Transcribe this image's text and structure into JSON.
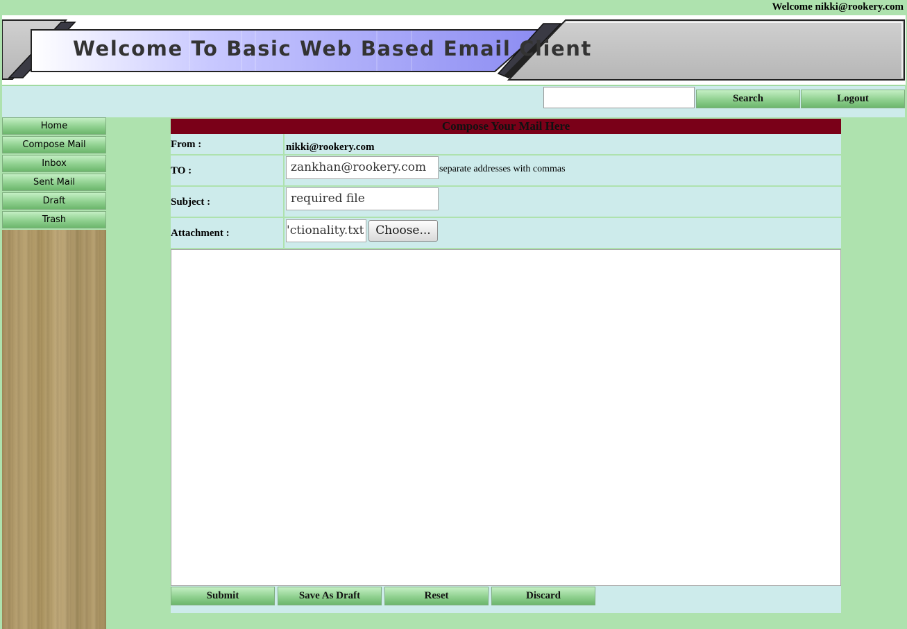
{
  "header": {
    "welcome": "Welcome nikki@rookery.com",
    "banner_title": "Welcome To Basic Web Based Email Client"
  },
  "toolbar": {
    "search_value": "",
    "search_label": "Search",
    "logout_label": "Logout"
  },
  "sidebar": {
    "items": [
      {
        "label": "Home"
      },
      {
        "label": "Compose Mail"
      },
      {
        "label": "Inbox"
      },
      {
        "label": "Sent Mail"
      },
      {
        "label": "Draft"
      },
      {
        "label": "Trash"
      }
    ]
  },
  "compose": {
    "title": "Compose Your Mail Here",
    "from_label": "From :",
    "from_value": "nikki@rookery.com",
    "to_label": "TO :",
    "to_value": "zankhan@rookery.com",
    "to_hint": "separate addresses with commas",
    "subject_label": "Subject :",
    "subject_value": "required file",
    "attachment_label": "Attachment :",
    "attachment_value": "ctionality.txt'",
    "choose_label": "Choose...",
    "body": ""
  },
  "actions": {
    "submit": "Submit",
    "save_draft": "Save As Draft",
    "reset": "Reset",
    "discard": "Discard"
  }
}
